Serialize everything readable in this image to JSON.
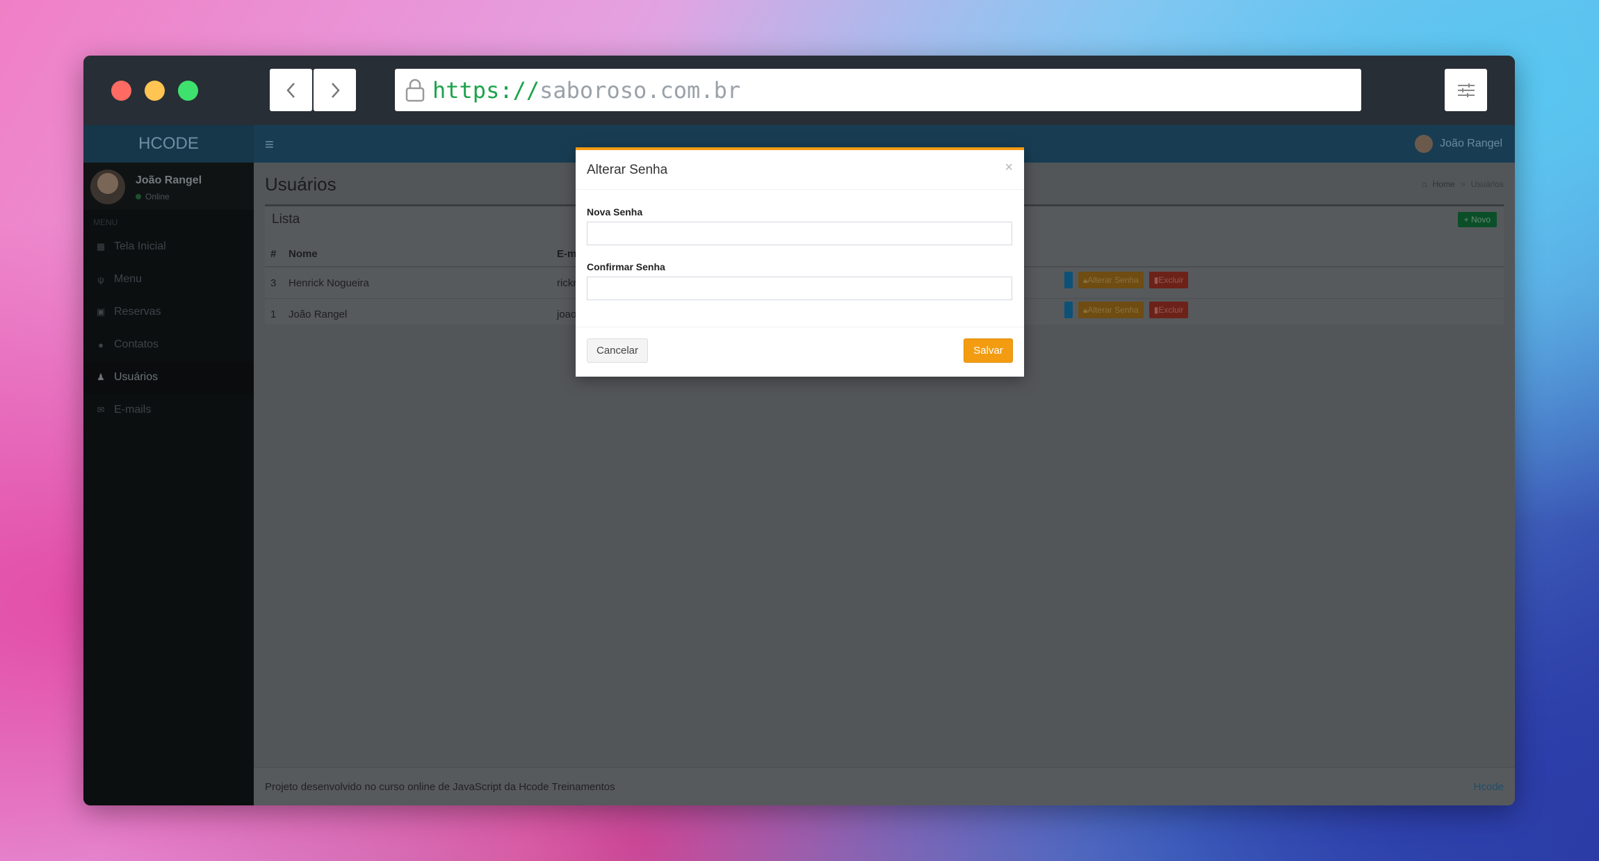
{
  "browser": {
    "url_scheme": "https://",
    "url_host": "saboroso.com.br",
    "back_icon": "chevron-left-icon",
    "forward_icon": "chevron-right-icon",
    "settings_icon": "sliders-icon"
  },
  "app": {
    "logo": "HCODE",
    "topbar_user": "João Rangel"
  },
  "sidebar": {
    "user_name": "João Rangel",
    "user_status": "Online",
    "menu_header": "MENU",
    "items": [
      {
        "label": "Tela Inicial",
        "icon": "dashboard-icon"
      },
      {
        "label": "Menu",
        "icon": "cutlery-icon"
      },
      {
        "label": "Reservas",
        "icon": "calendar-icon"
      },
      {
        "label": "Contatos",
        "icon": "comments-icon"
      },
      {
        "label": "Usuários",
        "icon": "users-icon"
      },
      {
        "label": "E-mails",
        "icon": "envelope-icon"
      }
    ]
  },
  "page": {
    "title": "Usuários",
    "breadcrumb_home": "Home",
    "breadcrumb_current": "Usuários"
  },
  "list": {
    "title": "Lista",
    "new_button": "+ Novo",
    "headers": [
      "#",
      "Nome",
      "E-m"
    ],
    "rows": [
      {
        "id": "3",
        "name": "Henrick Nogueira",
        "email": "rickr"
      },
      {
        "id": "1",
        "name": "João Rangel",
        "email": "joao"
      }
    ],
    "alter_button": "Alterar Senha",
    "delete_button": "Excluir"
  },
  "footer": {
    "text": "Projeto desenvolvido no curso online de JavaScript da Hcode Treinamentos",
    "link": "Hcode"
  },
  "modal": {
    "title": "Alterar Senha",
    "close": "×",
    "field1_label": "Nova Senha",
    "field1_value": "",
    "field2_label": "Confirmar Senha",
    "field2_value": "",
    "cancel": "Cancelar",
    "save": "Salvar"
  },
  "colors": {
    "accent": "#f39c12",
    "url_scheme": "#1ca34c"
  }
}
